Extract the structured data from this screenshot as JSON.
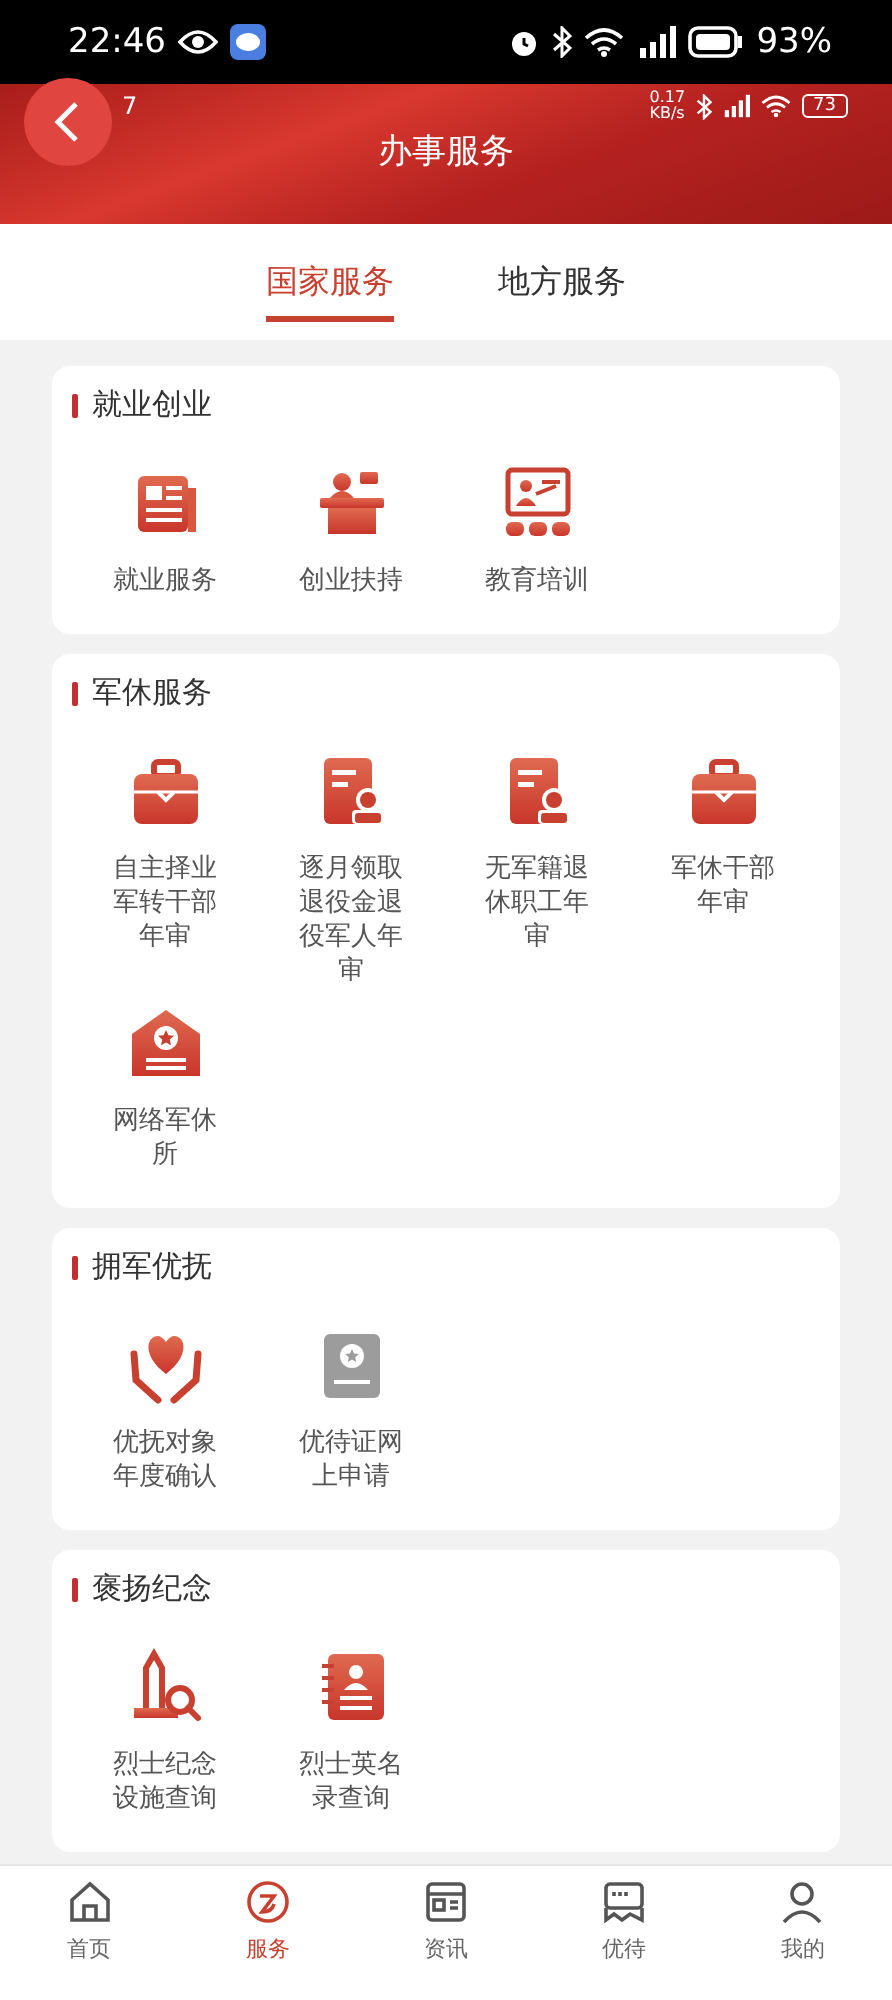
{
  "status_bar": {
    "time": "22:46",
    "battery": "93%"
  },
  "header": {
    "title": "办事服务",
    "inner_time": "7",
    "net_speed": "0.17",
    "net_unit": "KB/s",
    "inner_battery": "73"
  },
  "tabs": [
    {
      "label": "国家服务",
      "selected": true
    },
    {
      "label": "地方服务",
      "selected": false
    }
  ],
  "sections": [
    {
      "title": "就业创业",
      "items": [
        {
          "label": "就业服务",
          "kind": "newspaper"
        },
        {
          "label": "创业扶持",
          "kind": "desk"
        },
        {
          "label": "教育培训",
          "kind": "teaching"
        }
      ]
    },
    {
      "title": "军休服务",
      "items": [
        {
          "label": "自主择业军转干部年审",
          "kind": "briefcase"
        },
        {
          "label": "逐月领取退役金退役军人年审",
          "kind": "certificate"
        },
        {
          "label": "无军籍退休职工年审",
          "kind": "certificate"
        },
        {
          "label": "军休干部年审",
          "kind": "briefcase"
        },
        {
          "label": "网络军休所",
          "kind": "building"
        }
      ]
    },
    {
      "title": "拥军优抚",
      "items": [
        {
          "label": "优抚对象年度确认",
          "kind": "heart"
        },
        {
          "label": "优待证网上申请",
          "kind": "card"
        }
      ]
    },
    {
      "title": "褒扬纪念",
      "items": [
        {
          "label": "烈士纪念设施查询",
          "kind": "monument"
        },
        {
          "label": "烈士英名录查询",
          "kind": "roster"
        }
      ]
    }
  ],
  "bottom_nav": [
    {
      "label": "首页",
      "kind": "home",
      "selected": false
    },
    {
      "label": "服务",
      "kind": "service",
      "selected": true
    },
    {
      "label": "资讯",
      "kind": "news",
      "selected": false
    },
    {
      "label": "优待",
      "kind": "voucher",
      "selected": false
    },
    {
      "label": "我的",
      "kind": "profile",
      "selected": false
    }
  ]
}
